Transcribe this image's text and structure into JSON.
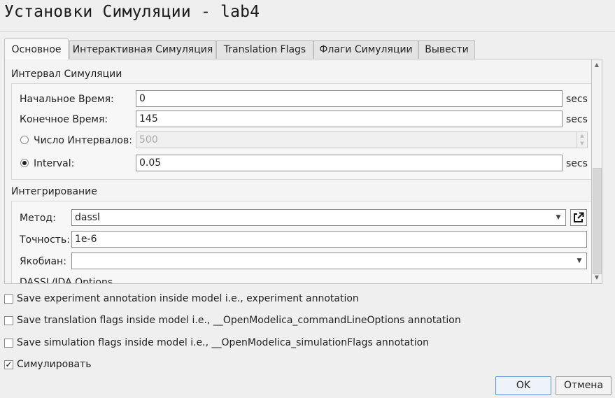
{
  "window": {
    "title": "Установки Симуляции - lab4"
  },
  "tabs": [
    {
      "label": "Основное",
      "active": true
    },
    {
      "label": "Интерактивная Симуляция",
      "active": false
    },
    {
      "label": "Translation Flags",
      "active": false
    },
    {
      "label": "Флаги Симуляции",
      "active": false
    },
    {
      "label": "Вывести",
      "active": false
    }
  ],
  "interval": {
    "group_title": "Интервал Симуляции",
    "start": {
      "label": "Начальное Время:",
      "value": "0",
      "unit": "secs"
    },
    "stop": {
      "label": "Конечное Время:",
      "value": "145",
      "unit": "secs"
    },
    "num_intervals": {
      "label": "Число Интервалов:",
      "value": "500",
      "selected": false,
      "enabled": false
    },
    "interval": {
      "label": "Interval:",
      "value": "0.05",
      "unit": "secs",
      "selected": true
    }
  },
  "integration": {
    "group_title": "Интегрирование",
    "method": {
      "label": "Метод:",
      "value": "dassl"
    },
    "tolerance": {
      "label": "Точность:",
      "value": "1e-6"
    },
    "jacobian": {
      "label": "Якобиан:",
      "value": ""
    },
    "dassl_options_title": "DASSL/IDA Options"
  },
  "checkboxes": [
    {
      "label": "Save experiment annotation inside model i.e., experiment annotation",
      "checked": false
    },
    {
      "label": "Save translation flags inside model i.e., __OpenModelica_commandLineOptions annotation",
      "checked": false
    },
    {
      "label": "Save simulation flags inside model i.e., __OpenModelica_simulationFlags annotation",
      "checked": false
    },
    {
      "label": "Симулировать",
      "checked": true
    }
  ],
  "buttons": {
    "ok": "OK",
    "cancel": "Отмена"
  },
  "icons": {
    "external_link": "open-external-icon",
    "check_mark": "✓"
  },
  "colors": {
    "background": "#efefef",
    "default_button_border": "#5f8ec9"
  }
}
